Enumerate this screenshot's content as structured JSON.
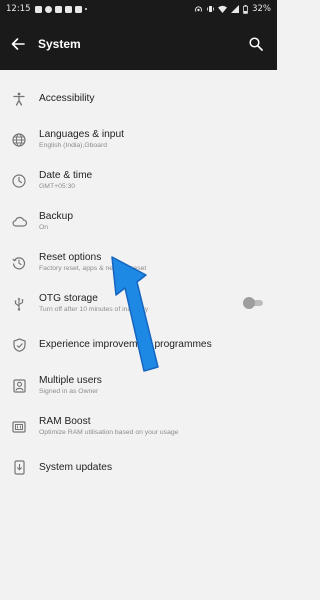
{
  "status_bar": {
    "time": "12:15",
    "battery": "32%"
  },
  "app_bar": {
    "title": "System"
  },
  "settings": [
    {
      "title": "Accessibility",
      "subtitle": "",
      "icon": "accessibility-icon"
    },
    {
      "title": "Languages & input",
      "subtitle": "English (India),Gboard",
      "icon": "globe-icon"
    },
    {
      "title": "Date & time",
      "subtitle": "GMT+05:30",
      "icon": "clock-icon"
    },
    {
      "title": "Backup",
      "subtitle": "On",
      "icon": "cloud-icon"
    },
    {
      "title": "Reset options",
      "subtitle": "Factory reset, apps & network reset",
      "icon": "history-icon"
    },
    {
      "title": "OTG storage",
      "subtitle": "Turn off after 10 minutes of inactivity",
      "icon": "usb-icon",
      "toggle": false
    },
    {
      "title": "Experience improvement programmes",
      "subtitle": "",
      "icon": "shield-icon"
    },
    {
      "title": "Multiple users",
      "subtitle": "Signed in as Owner",
      "icon": "user-icon"
    },
    {
      "title": "RAM Boost",
      "subtitle": "Optimize RAM utilisation based on your usage",
      "icon": "ram-icon"
    },
    {
      "title": "System updates",
      "subtitle": "",
      "icon": "system-update-icon"
    }
  ],
  "colors": {
    "bar_background": "#1a1a1a",
    "page_background": "#f2f2f2",
    "arrow": "#1e88e5"
  }
}
